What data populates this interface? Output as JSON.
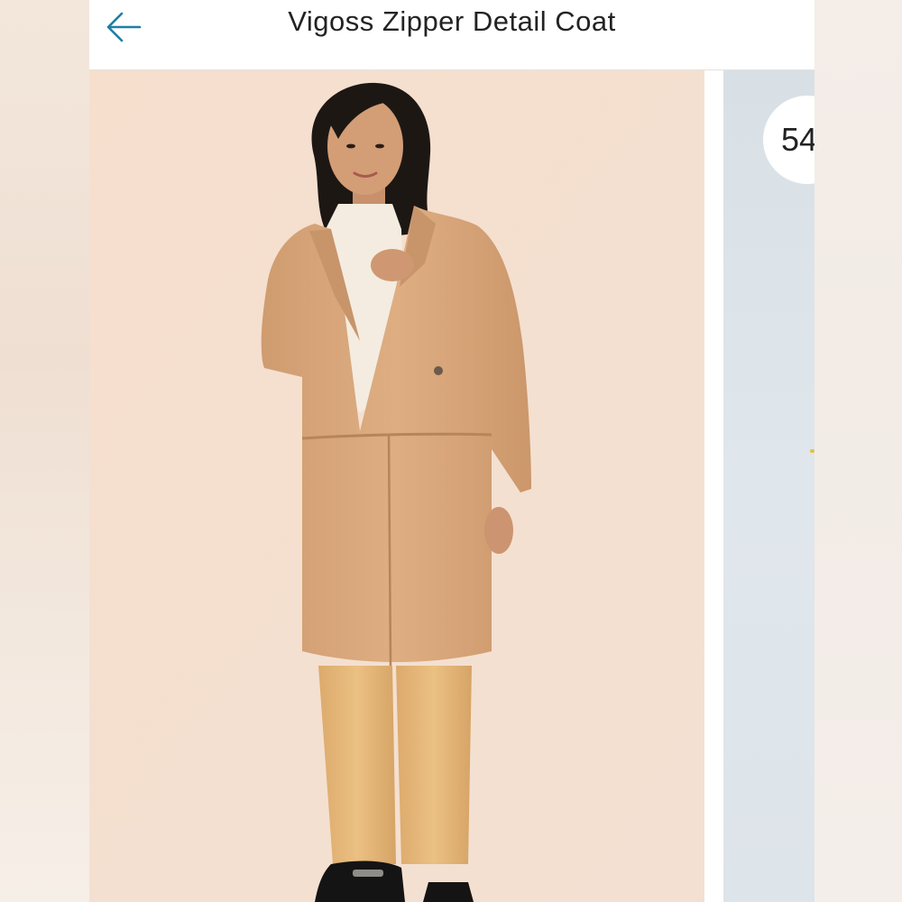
{
  "header": {
    "back_icon": "arrow-left-icon",
    "title": "Vigoss Zipper Detail Coat"
  },
  "carousel": {
    "main_image": "Woman wearing a tan teddy zipper-detail coat over a cream turtleneck with tan pants and black loafers",
    "next_card": {
      "label": "54"
    }
  },
  "colors": {
    "accent": "#1f7fa6",
    "photo_background": "#f5e1d1",
    "coat": "#d9a97c",
    "pants": "#e3b577",
    "next_card_background": "#dde4ea"
  }
}
